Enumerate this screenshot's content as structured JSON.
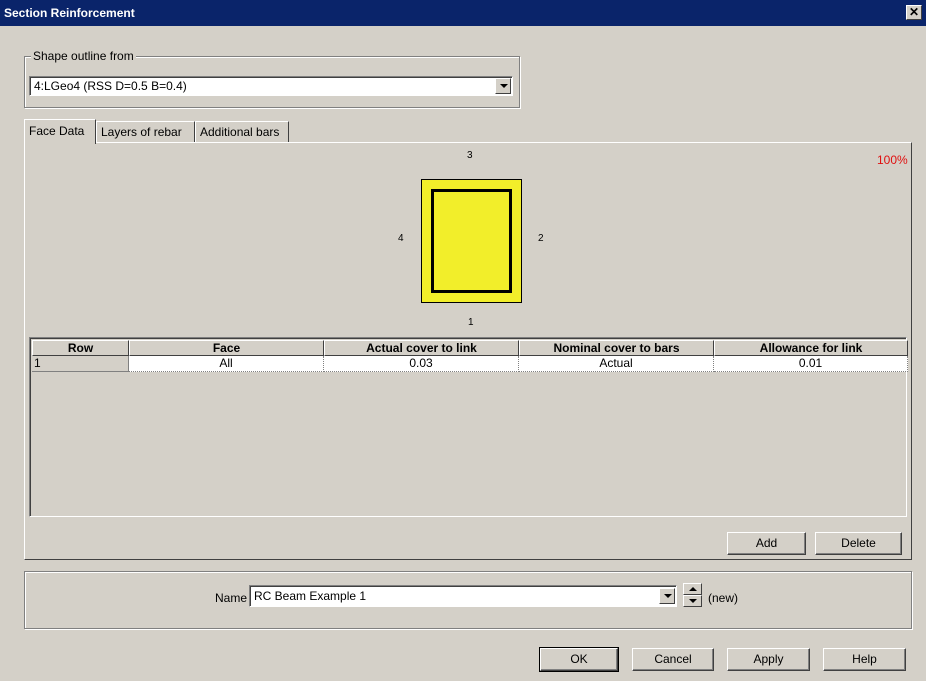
{
  "window": {
    "title": "Section Reinforcement",
    "close_glyph": "✕"
  },
  "shape_outline": {
    "label": "Shape outline from",
    "selected": "4:LGeo4 (RSS D=0.5 B=0.4)"
  },
  "tabs": [
    {
      "label": "Face Data",
      "active": true
    },
    {
      "label": "Layers of rebar",
      "active": false
    },
    {
      "label": "Additional bars",
      "active": false
    }
  ],
  "section_preview": {
    "face_top": "3",
    "face_right": "2",
    "face_bottom": "1",
    "face_left": "4",
    "zoom": "100%",
    "fill_color": "#f2ee2a"
  },
  "grid": {
    "columns": [
      "Row",
      "Face",
      "Actual cover to link",
      "Nominal cover to bars",
      "Allowance for link"
    ],
    "rows": [
      {
        "row": "1",
        "face": "All",
        "actual_cover": "0.03",
        "nominal_cover": "Actual",
        "allowance": "0.01"
      }
    ]
  },
  "grid_buttons": {
    "add": "Add",
    "delete": "Delete"
  },
  "name_field": {
    "label": "Name",
    "value": "RC Beam Example 1",
    "status": "(new)"
  },
  "dialog_buttons": {
    "ok": "OK",
    "cancel": "Cancel",
    "apply": "Apply",
    "help": "Help"
  },
  "colors": {
    "titlebar": "#0a246a",
    "dialog_bg": "#d4d0c8",
    "zoom_text": "#e01010"
  }
}
